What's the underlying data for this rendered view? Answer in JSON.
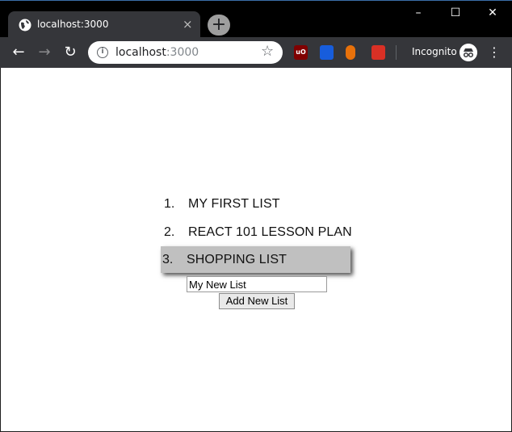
{
  "browser": {
    "tab": {
      "title": "localhost:3000",
      "close_glyph": "×",
      "favicon": "globe-icon"
    },
    "new_tab_glyph": "+",
    "window_controls": {
      "minimize": "–",
      "maximize": "☐",
      "close": "✕"
    },
    "nav": {
      "back": "←",
      "forward": "→",
      "reload": "↻"
    },
    "address": {
      "host": "localhost",
      "port": ":3000",
      "info_glyph": "i",
      "star_glyph": "☆"
    },
    "extensions": [
      {
        "name": "ublock-icon",
        "text": "uO",
        "color": "#800000"
      },
      {
        "name": "bitwarden-icon",
        "text": "",
        "color": "#175ddc"
      },
      {
        "name": "extension-orange-icon",
        "text": "",
        "color": "#e8710a"
      },
      {
        "name": "extension-red-icon",
        "text": "",
        "color": "#d93025"
      }
    ],
    "incognito_label": "Incognito",
    "menu_glyph": "⋮"
  },
  "app": {
    "lists": [
      {
        "number": "1.",
        "label": "MY FIRST LIST",
        "selected": false
      },
      {
        "number": "2.",
        "label": "REACT 101 LESSON PLAN",
        "selected": false
      },
      {
        "number": "3.",
        "label": "SHOPPING LIST",
        "selected": true
      }
    ],
    "new_list_input": {
      "value": "My New List"
    },
    "add_button_label": "Add New List"
  }
}
